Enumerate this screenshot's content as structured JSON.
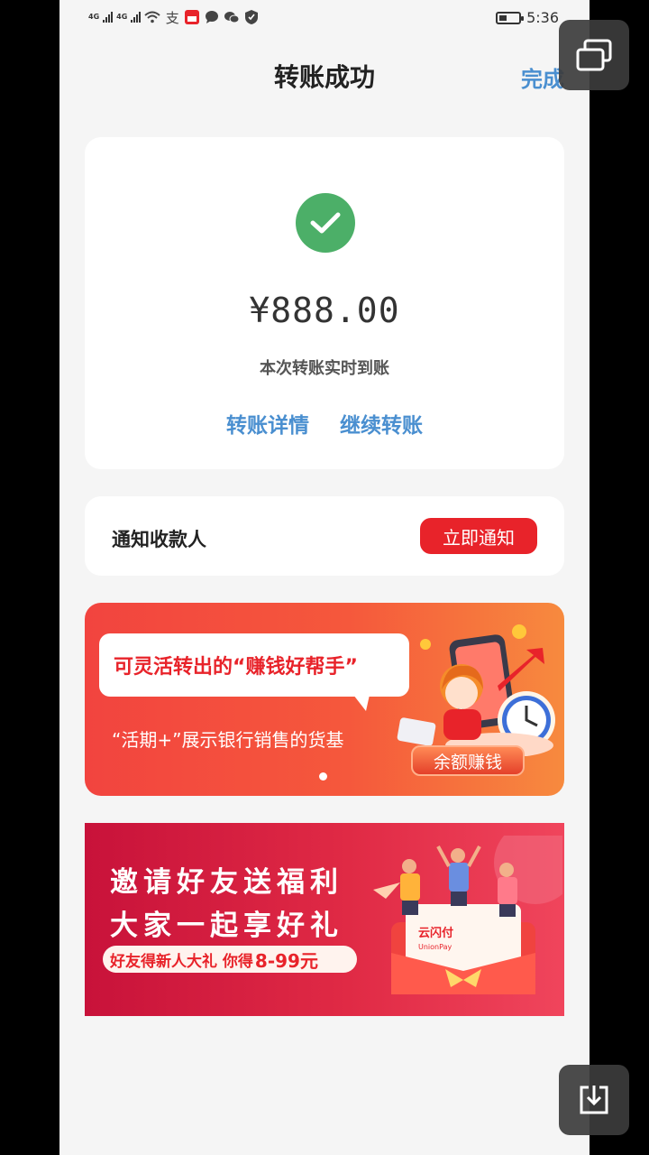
{
  "status_bar": {
    "signal1_label": "4G",
    "signal2_label": "4G",
    "time": "5:36"
  },
  "header": {
    "title": "转账成功",
    "done_label": "完成"
  },
  "result": {
    "amount": "¥888.00",
    "subtitle": "本次转账实时到账",
    "details_link": "转账详情",
    "continue_link": "继续转账",
    "success_color": "#4caf68"
  },
  "notify": {
    "label": "通知收款人",
    "button": "立即通知",
    "button_color": "#e8232a"
  },
  "banner1": {
    "headline": "可灵活转出的“赚钱好帮手”",
    "subtitle": "“活期+”展示银行销售的货基",
    "button": "余额赚钱"
  },
  "banner2": {
    "line1": "邀请好友送福利",
    "line2": "大家一起享好礼",
    "pill_text": "好友得新人大礼 你得",
    "pill_highlight": "8-99元",
    "envelope_brand": "云闪付",
    "envelope_brand_en": "UnionPay"
  },
  "colors": {
    "accent_blue": "#4a8fd0",
    "brand_red": "#e8232a"
  }
}
